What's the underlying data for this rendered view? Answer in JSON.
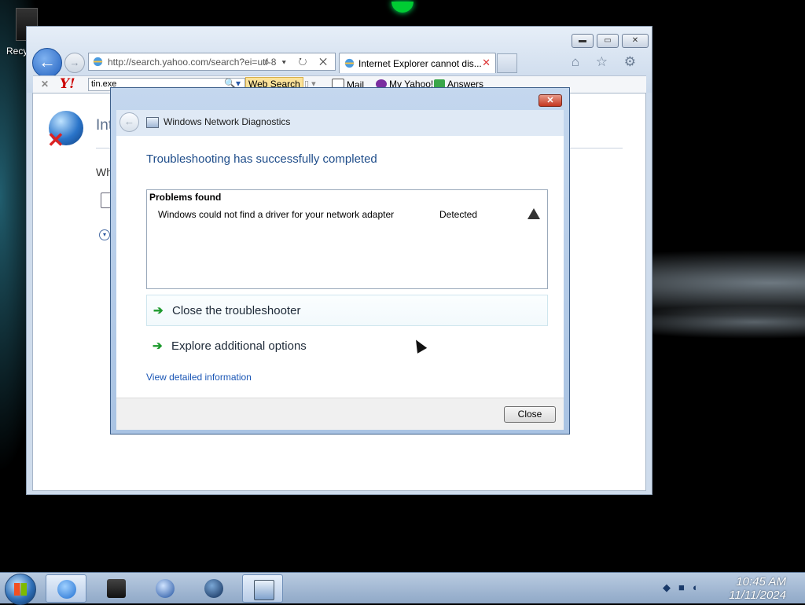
{
  "desktop": {
    "recycle_label": "Recy"
  },
  "browser": {
    "address": "http://search.yahoo.com/search?ei=utf-8",
    "address_tools": "⌕ ▾ ↻ ✕",
    "tab_title": "Internet Explorer cannot dis...",
    "tab_close": "✕",
    "window_buttons": {
      "minimize": "▬",
      "maximize": "▭",
      "close": "✕"
    },
    "right_icons": "⌂ ☆ ⚙",
    "back_glyph": "←",
    "forward_glyph": "→"
  },
  "yahoo_toolbar": {
    "close": "✕",
    "logo": "Y!",
    "search_value": "tin.exe",
    "search_icon": "🔍▾",
    "web_search_label": "Web Search",
    "misc": "▯ ▾",
    "mail_label": "Mail",
    "my_yahoo_label": "My Yahoo!",
    "answers_label": "Answers"
  },
  "ie_page": {
    "title": "Int",
    "what_text": "Wh",
    "expand_glyph": "▾"
  },
  "dialog": {
    "title": "Windows Network Diagnostics",
    "close_glyph": "✕",
    "back_glyph": "←",
    "heading": "Troubleshooting has successfully completed",
    "problems_header": "Problems found",
    "problems": [
      {
        "description": "Windows could not find a driver for your network adapter",
        "status": "Detected"
      }
    ],
    "options": [
      {
        "label": "Close the troubleshooter"
      },
      {
        "label": "Explore additional options"
      }
    ],
    "arrow_glyph": "➔",
    "detail_link": "View detailed information",
    "close_button": "Close"
  },
  "taskbar": {
    "time": "10:45 AM",
    "date": "11/11/2024"
  },
  "colors": {
    "dialog_heading": "#1f4d8a",
    "link": "#1a56b5",
    "option_arrow": "#1e9a2e"
  }
}
